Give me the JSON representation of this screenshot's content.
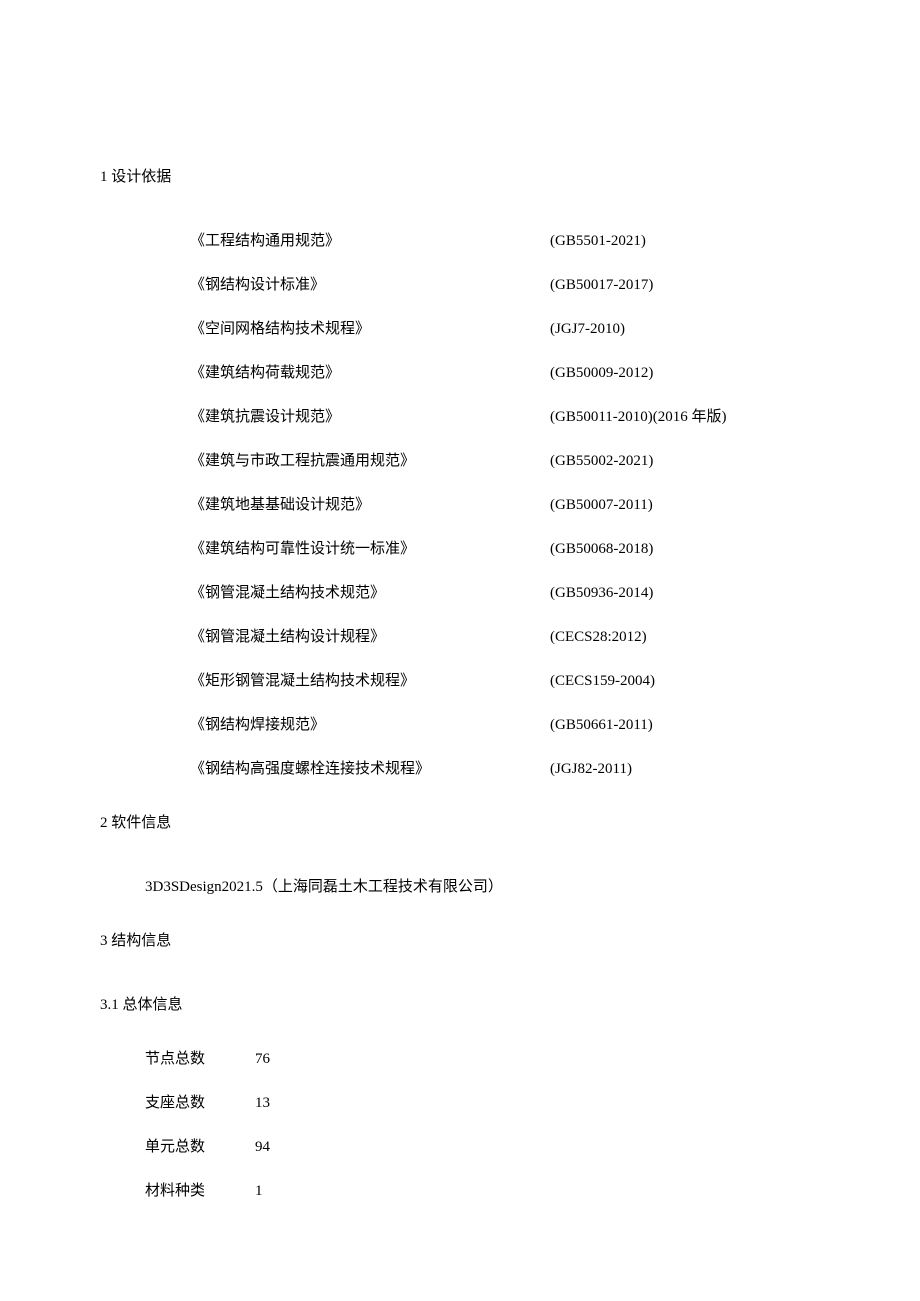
{
  "sections": {
    "s1": {
      "heading": "1 设计依据",
      "standards": [
        {
          "name": "《工程结构通用规范》",
          "code": "(GB5501-2021)"
        },
        {
          "name": "《钢结构设计标准》",
          "code": "(GB50017-2017)"
        },
        {
          "name": "《空间网格结构技术规程》",
          "code": "(JGJ7-2010)"
        },
        {
          "name": "《建筑结构荷载规范》",
          "code": "(GB50009-2012)"
        },
        {
          "name": "《建筑抗震设计规范》",
          "code": "(GB50011-2010)(2016 年版)"
        },
        {
          "name": "《建筑与市政工程抗震通用规范》",
          "code": "(GB55002-2021)"
        },
        {
          "name": "《建筑地基基础设计规范》",
          "code": "(GB50007-2011)"
        },
        {
          "name": "《建筑结构可靠性设计统一标准》",
          "code": "(GB50068-2018)"
        },
        {
          "name": "《钢管混凝土结构技术规范》",
          "code": "(GB50936-2014)"
        },
        {
          "name": "《钢管混凝土结构设计规程》",
          "code": "(CECS28:2012)"
        },
        {
          "name": "《矩形钢管混凝土结构技术规程》",
          "code": "(CECS159-2004)"
        },
        {
          "name": "《钢结构焊接规范》",
          "code": "(GB50661-2011)"
        },
        {
          "name": "《钢结构高强度螺栓连接技术规程》",
          "code": "(JGJ82-2011)"
        }
      ]
    },
    "s2": {
      "heading": "2 软件信息",
      "text": "3D3SDesign2021.5（上海同磊土木工程技术有限公司）"
    },
    "s3": {
      "heading": "3 结构信息"
    },
    "s3_1": {
      "heading": "3.1 总体信息",
      "rows": [
        {
          "label": "节点总数",
          "value": "76"
        },
        {
          "label": "支座总数",
          "value": "13"
        },
        {
          "label": "单元总数",
          "value": "94"
        },
        {
          "label": "材料种类",
          "value": "1"
        }
      ]
    }
  }
}
